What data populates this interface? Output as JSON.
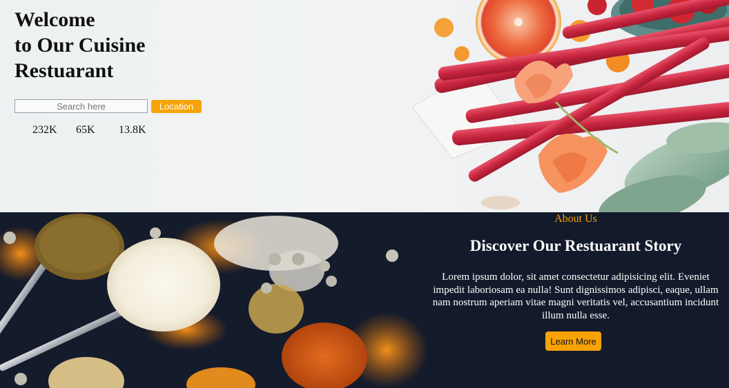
{
  "hero": {
    "title_lines": [
      "Welcome",
      "to Our Cuisine",
      "Restuarant"
    ],
    "search": {
      "placeholder": "Search here",
      "value": ""
    },
    "location_button": "Location",
    "stats": [
      "232K",
      "65K",
      "13.8K"
    ]
  },
  "about": {
    "label": "About Us",
    "heading": "Discover Our Restuarant Story",
    "text": "Lorem ipsum dolor, sit amet consectetur adipisicing elit. Eveniet impedit laboriosam ea nulla! Sunt dignissimos adipisci, eaque, ullam nam nostrum aperiam vitae magni veritatis vel, accusantium incidunt illum nulla esse.",
    "button": "Learn More"
  },
  "colors": {
    "accent": "#f7a307",
    "about_background": "#131a2b",
    "hero_background": "#f0f2f3"
  }
}
